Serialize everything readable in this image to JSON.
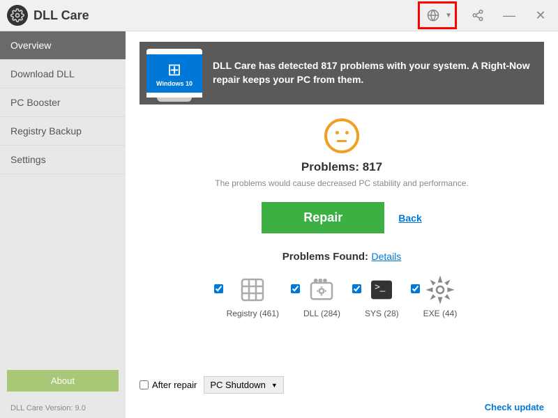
{
  "app": {
    "title": "DLL Care",
    "version_label": "DLL Care Version: 9.0"
  },
  "sidebar": {
    "items": [
      {
        "label": "Overview"
      },
      {
        "label": "Download DLL"
      },
      {
        "label": "PC Booster"
      },
      {
        "label": "Registry Backup"
      },
      {
        "label": "Settings"
      }
    ],
    "about_label": "About"
  },
  "banner": {
    "os_label": "Windows 10",
    "text": "DLL Care has detected 817 problems with your system. A Right-Now repair keeps your PC from them."
  },
  "main": {
    "problems_label": "Problems: 817",
    "problems_desc": "The problems would cause decreased PC stability and performance.",
    "repair_label": "Repair",
    "back_label": "Back"
  },
  "found": {
    "title": "Problems Found:",
    "details_label": "Details",
    "categories": [
      {
        "name": "Registry",
        "count": "(461)"
      },
      {
        "name": "DLL",
        "count": "(284)"
      },
      {
        "name": "SYS",
        "count": "(28)"
      },
      {
        "name": "EXE",
        "count": "(44)"
      }
    ]
  },
  "bottom": {
    "after_repair_label": "After repair",
    "dropdown_value": "PC Shutdown",
    "check_update_label": "Check update"
  }
}
